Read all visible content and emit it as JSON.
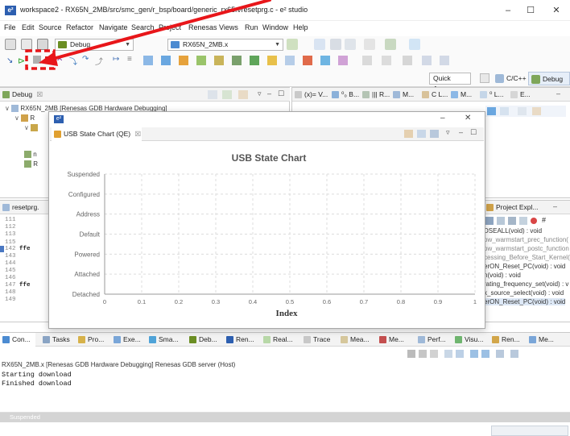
{
  "window": {
    "app_icon_label": "e²",
    "title": "workspace2 - RX65N_2MB/src/smc_gen/r_bsp/board/generic_rx65n/resetprg.c - e² studio",
    "minimize": "–",
    "maximize": "☐",
    "close": "✕"
  },
  "menu": [
    "File",
    "Edit",
    "Source",
    "Refactor",
    "Navigate",
    "Search",
    "Project",
    "Renesas Views",
    "Run",
    "Window",
    "Help"
  ],
  "toolbar": {
    "debug_config": "Debug",
    "target_config": "RX65N_2MB.x",
    "quick_access": "Quick Access",
    "perspective_c": "C/C++",
    "perspective_debug": "Debug"
  },
  "debug_view": {
    "tab_label": "Debug",
    "tab_suffix": "☒",
    "tree": [
      "RX65N_2MB [Renesas GDB Hardware Debugging]",
      "R",
      "",
      "n",
      "R"
    ]
  },
  "right_views": {
    "tabs": [
      "(x)= V...",
      "⁰₀ B...",
      "||| R...",
      "M...",
      "C L...",
      "M...",
      "⁰ L...",
      "E..."
    ]
  },
  "editor": {
    "tab_label": "resetprg.",
    "lines": [
      {
        "no": "111",
        "text": ""
      },
      {
        "no": "112",
        "text": ""
      },
      {
        "no": "113",
        "text": ""
      },
      {
        "no": "115",
        "text": ""
      },
      {
        "no": "142",
        "text": "ffe"
      },
      {
        "no": "143",
        "text": ""
      },
      {
        "no": "144",
        "text": ""
      },
      {
        "no": "145",
        "text": ""
      },
      {
        "no": "146",
        "text": ""
      },
      {
        "no": "147",
        "text": "ffe"
      },
      {
        "no": "148",
        "text": ""
      },
      {
        "no": "149",
        "text": ""
      }
    ]
  },
  "outline": {
    "tab_label": "Project Expl...",
    "rows": [
      "DSEALL(void) : void",
      "ow_warmstart_prec_function(",
      "ow_warmstart_postc_function",
      "cessing_Before_Start_Kernel(v",
      "erON_Reset_PC(void) : void",
      "n(void) : void",
      "rating_frequency_set(void) : v",
      "k_source_select(void) : void",
      "erON_Reset_PC(void) : void"
    ]
  },
  "modal": {
    "icon_label": "e²",
    "tab_label": "USB State Chart (QE)",
    "tab_close": "☒",
    "minimize": "–",
    "maximize": "☐",
    "close": "✕"
  },
  "chart_data": {
    "type": "line",
    "title": "USB State Chart",
    "xlabel": "Index",
    "ylabel": "",
    "categories_y": [
      "Suspended",
      "Configured",
      "Address",
      "Default",
      "Powered",
      "Attached",
      "Detached"
    ],
    "x_ticks": [
      "0",
      "0.1",
      "0.2",
      "0.3",
      "0.4",
      "0.5",
      "0.6",
      "0.7",
      "0.8",
      "0.9",
      "1"
    ],
    "xlim": [
      0,
      1
    ],
    "series": [],
    "grid": true
  },
  "bottom_tabs": [
    "Con...",
    "Tasks",
    "Pro...",
    "Exe...",
    "Sma...",
    "Deb...",
    "Ren...",
    "Real...",
    "Trace",
    "Mea...",
    "Me...",
    "Perf...",
    "Visu...",
    "Ren...",
    "Me..."
  ],
  "console": {
    "header": "RX65N_2MB.x [Renesas GDB Hardware Debugging] Renesas GDB server (Host)",
    "lines": [
      "Starting download",
      "Finished download"
    ]
  },
  "status": {
    "state": "Suspended"
  },
  "colors": {
    "annotation_red": "#e8161a",
    "accent_blue": "#2d5fb0",
    "panel_border": "#c9c9c9"
  }
}
